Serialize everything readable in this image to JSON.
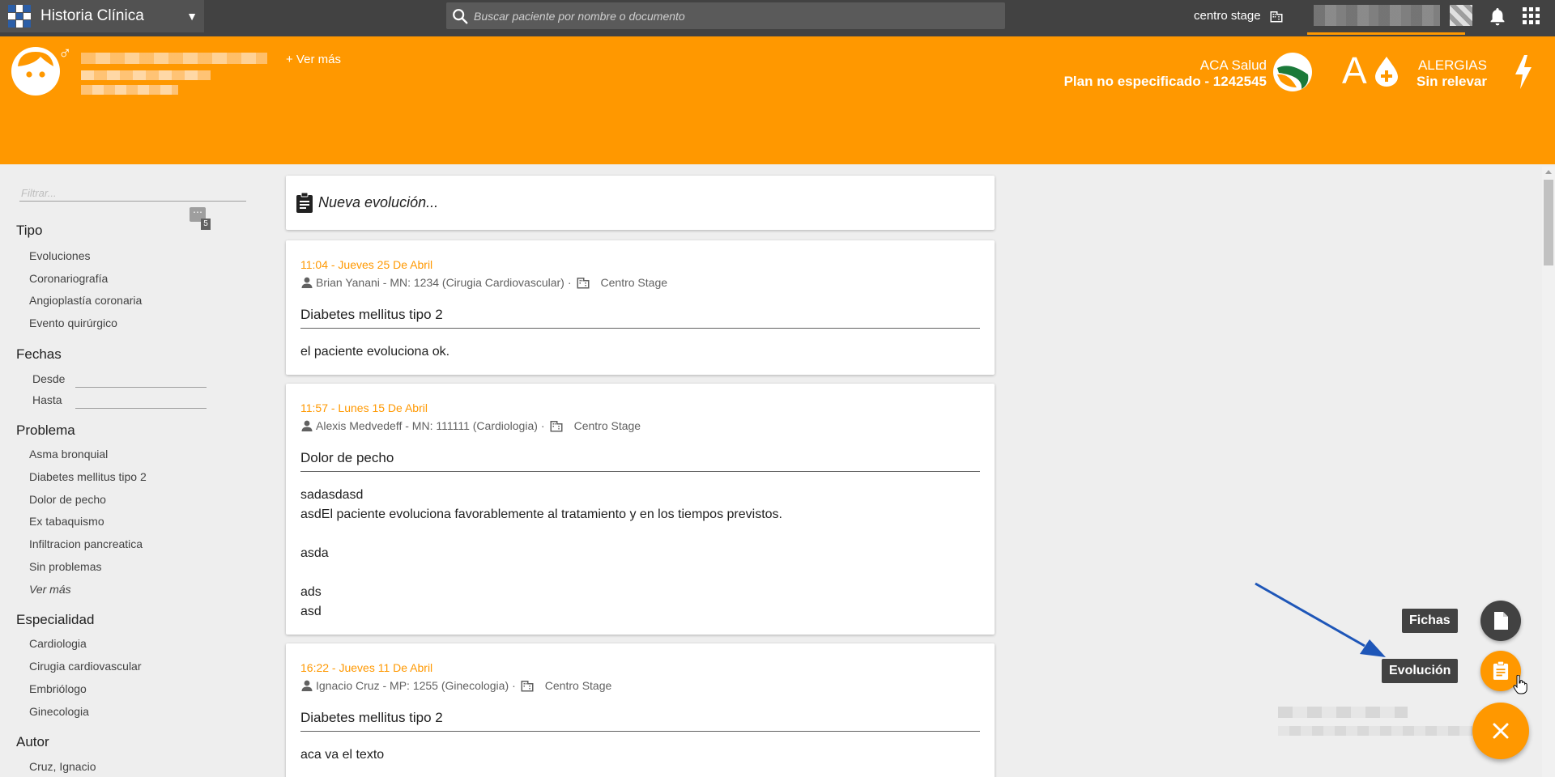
{
  "topbar": {
    "app_title": "Historia Clínica",
    "search_placeholder": "Buscar paciente por nombre o documento",
    "center": "centro stage"
  },
  "patient": {
    "ver_mas": "+ Ver más",
    "insurance_name": "ACA Salud",
    "insurance_plan": "Plan no especificado - 1242545",
    "blood_group": "A",
    "allergies_label": "ALERGIAS",
    "allergies_value": "Sin relevar"
  },
  "sidebar": {
    "filter_placeholder": "Filtrar...",
    "tipo_title": "Tipo",
    "tipo_items": [
      "Evoluciones",
      "Coronariografía",
      "Angioplastía coronaria",
      "Evento quirúrgico"
    ],
    "fechas_title": "Fechas",
    "desde": "Desde",
    "hasta": "Hasta",
    "calendar_badge": "5",
    "problema_title": "Problema",
    "problema_items": [
      "Asma bronquial",
      "Diabetes mellitus tipo 2",
      "Dolor de pecho",
      "Ex tabaquismo",
      "Infiltracion pancreatica",
      "Sin problemas"
    ],
    "ver_mas": "Ver más",
    "especialidad_title": "Especialidad",
    "especialidad_items": [
      "Cardiologia",
      "Cirugia cardiovascular",
      "Embriólogo",
      "Ginecologia"
    ],
    "autor_title": "Autor",
    "autor_items": [
      "Cruz, Ignacio"
    ]
  },
  "new_evolution": "Nueva evolución...",
  "evolutions": [
    {
      "date": "11:04 - Jueves 25 De Abril",
      "author": "Brian Yanani - MN: 1234 (Cirugia Cardiovascular)",
      "center": "Centro Stage",
      "problem": "Diabetes mellitus tipo 2",
      "body": "el paciente evoluciona ok."
    },
    {
      "date": "11:57 - Lunes 15 De Abril",
      "author": "Alexis Medvedeff - MN: 111111 (Cardiologia)",
      "center": "Centro Stage",
      "problem": "Dolor de pecho",
      "body": "sadasdasd\nasdEl paciente evoluciona favorablemente al tratamiento y en los tiempos previstos.\n\nasda\n\nads\nasd"
    },
    {
      "date": "16:22 - Jueves 11 De Abril",
      "author": "Ignacio Cruz - MP: 1255 (Ginecologia)",
      "center": "Centro Stage",
      "problem": "Diabetes mellitus tipo 2",
      "body": "aca va el texto"
    }
  ],
  "fab": {
    "fichas": "Fichas",
    "evolucion": "Evolución"
  },
  "colors": {
    "accent": "#ff9800",
    "topbar": "#424242",
    "annotation_arrow": "#1e56b8"
  }
}
